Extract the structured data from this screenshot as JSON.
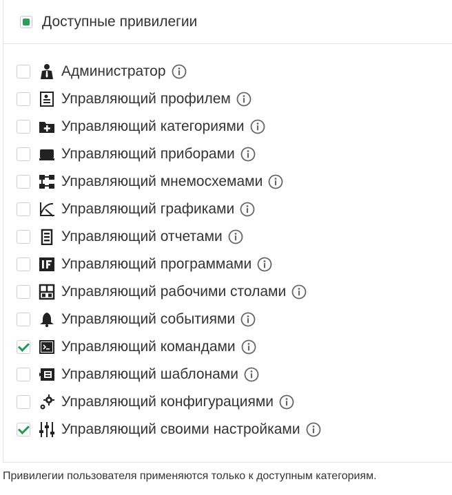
{
  "panel": {
    "title": "Доступные привилегии",
    "header_checked": true
  },
  "privileges": [
    {
      "label": "Администратор",
      "icon": "admin-user-icon",
      "checked": false
    },
    {
      "label": "Управляющий профилем",
      "icon": "profile-card-icon",
      "checked": false
    },
    {
      "label": "Управляющий категориями",
      "icon": "folder-plus-icon",
      "checked": false
    },
    {
      "label": "Управляющий приборами",
      "icon": "device-icon",
      "checked": false
    },
    {
      "label": "Управляющий мнемосхемами",
      "icon": "diagram-icon",
      "checked": false
    },
    {
      "label": "Управляющий графиками",
      "icon": "chart-curve-icon",
      "checked": false
    },
    {
      "label": "Управляющий отчетами",
      "icon": "report-icon",
      "checked": false
    },
    {
      "label": "Управляющий программами",
      "icon": "program-if-icon",
      "checked": false
    },
    {
      "label": "Управляющий рабочими столами",
      "icon": "dashboard-icon",
      "checked": false
    },
    {
      "label": "Управляющий событиями",
      "icon": "bell-icon",
      "checked": false
    },
    {
      "label": "Управляющий командами",
      "icon": "terminal-icon",
      "checked": true
    },
    {
      "label": "Управляющий шаблонами",
      "icon": "template-icon",
      "checked": false
    },
    {
      "label": "Управляющий конфигурациями",
      "icon": "gears-icon",
      "checked": false
    },
    {
      "label": "Управляющий своими настройками",
      "icon": "sliders-icon",
      "checked": true
    }
  ],
  "footer_note": "Привилегии пользователя применяются только к доступным категориям.",
  "colors": {
    "accent_green": "#24a15a",
    "text": "#333333",
    "border": "#e3e3e3"
  }
}
